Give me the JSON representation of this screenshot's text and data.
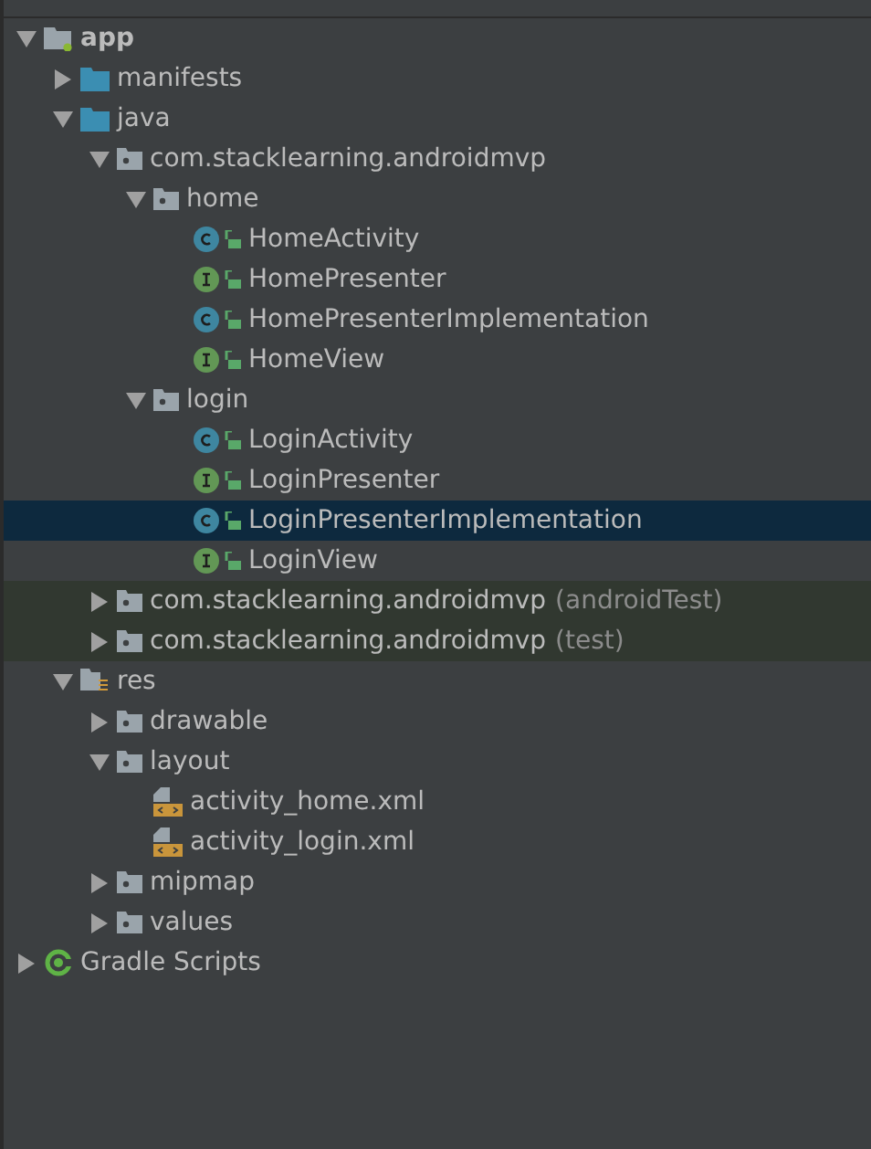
{
  "tree": [
    {
      "label": "app",
      "kind": "module",
      "expanded": true,
      "children": [
        {
          "label": "manifests",
          "kind": "folder",
          "expanded": false
        },
        {
          "label": "java",
          "kind": "folder",
          "expanded": true,
          "children": [
            {
              "label": "com.stacklearning.androidmvp",
              "kind": "package",
              "expanded": true,
              "children": [
                {
                  "label": "home",
                  "kind": "package",
                  "expanded": true,
                  "children": [
                    {
                      "label": "HomeActivity",
                      "kind": "class",
                      "selected": false
                    },
                    {
                      "label": "HomePresenter",
                      "kind": "interface",
                      "selected": false
                    },
                    {
                      "label": "HomePresenterImplementation",
                      "kind": "class",
                      "selected": false
                    },
                    {
                      "label": "HomeView",
                      "kind": "interface",
                      "selected": false
                    }
                  ]
                },
                {
                  "label": "login",
                  "kind": "package",
                  "expanded": true,
                  "children": [
                    {
                      "label": "LoginActivity",
                      "kind": "class",
                      "selected": false
                    },
                    {
                      "label": "LoginPresenter",
                      "kind": "interface",
                      "selected": false
                    },
                    {
                      "label": "LoginPresenterImplementation",
                      "kind": "class",
                      "selected": true
                    },
                    {
                      "label": "LoginView",
                      "kind": "interface",
                      "selected": false
                    }
                  ]
                }
              ]
            },
            {
              "label": "com.stacklearning.androidmvp",
              "suffix": "(androidTest)",
              "kind": "package",
              "test": true,
              "expanded": false
            },
            {
              "label": "com.stacklearning.androidmvp",
              "suffix": "(test)",
              "kind": "package",
              "test": true,
              "expanded": false
            }
          ]
        },
        {
          "label": "res",
          "kind": "resources",
          "expanded": true,
          "children": [
            {
              "label": "drawable",
              "kind": "package",
              "expanded": false
            },
            {
              "label": "layout",
              "kind": "package",
              "expanded": true,
              "children": [
                {
                  "label": "activity_home.xml",
                  "kind": "xml"
                },
                {
                  "label": "activity_login.xml",
                  "kind": "xml"
                }
              ]
            },
            {
              "label": "mipmap",
              "kind": "package",
              "expanded": false
            },
            {
              "label": "values",
              "kind": "package",
              "expanded": false
            }
          ]
        }
      ]
    },
    {
      "label": "Gradle Scripts",
      "kind": "gradle",
      "expanded": false
    }
  ]
}
